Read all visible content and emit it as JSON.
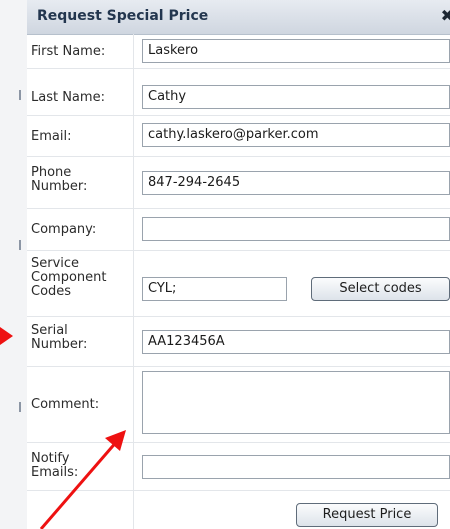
{
  "dialog": {
    "title": "Request Special Price",
    "close_glyph": "✖"
  },
  "form": {
    "first_name": {
      "label": "First Name:",
      "value": "Laskero"
    },
    "last_name": {
      "label": "Last Name:",
      "value": "Cathy"
    },
    "email": {
      "label": "Email:",
      "value": "cathy.laskero@parker.com"
    },
    "phone": {
      "label_line1": "Phone",
      "label_line2": "Number:",
      "value": "847-294-2645"
    },
    "company": {
      "label": "Company:",
      "value": ""
    },
    "service_codes": {
      "label_line1": "Service",
      "label_line2": "Component",
      "label_line3": "Codes",
      "value": "CYL;",
      "button": "Select codes"
    },
    "serial": {
      "label_line1": "Serial",
      "label_line2": "Number:",
      "value": "AA123456A"
    },
    "comment": {
      "label": "Comment:",
      "value": ""
    },
    "notify": {
      "label_line1": "Notify",
      "label_line2": "Emails:",
      "value": ""
    },
    "submit_button": "Request Price"
  },
  "annotation_color": "#ee1111",
  "icons": {
    "close": "close-icon",
    "arrows": "red-annotation-arrow"
  }
}
